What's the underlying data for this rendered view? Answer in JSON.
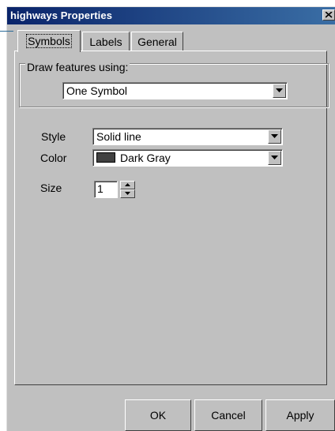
{
  "window": {
    "title": "highways Properties"
  },
  "tabs": [
    {
      "label": "Symbols",
      "active": true
    },
    {
      "label": "Labels",
      "active": false
    },
    {
      "label": "General",
      "active": false
    }
  ],
  "draw_features": {
    "group_label": "Draw features using:",
    "selected": "One Symbol"
  },
  "fields": {
    "style": {
      "label": "Style",
      "value": "Solid line"
    },
    "color": {
      "label": "Color",
      "value": "Dark Gray",
      "swatch": "#404040"
    },
    "size": {
      "label": "Size",
      "value": "1"
    }
  },
  "buttons": {
    "ok": "OK",
    "cancel": "Cancel",
    "apply": "Apply"
  },
  "icons": {
    "close": "close-icon",
    "dropdown": "chevron-down-icon",
    "spin_up": "chevron-up-icon",
    "spin_down": "chevron-down-icon"
  },
  "colors": {
    "titlebar_start": "#0a246a",
    "titlebar_end": "#3a6ea5",
    "face": "#c0c0c0"
  }
}
